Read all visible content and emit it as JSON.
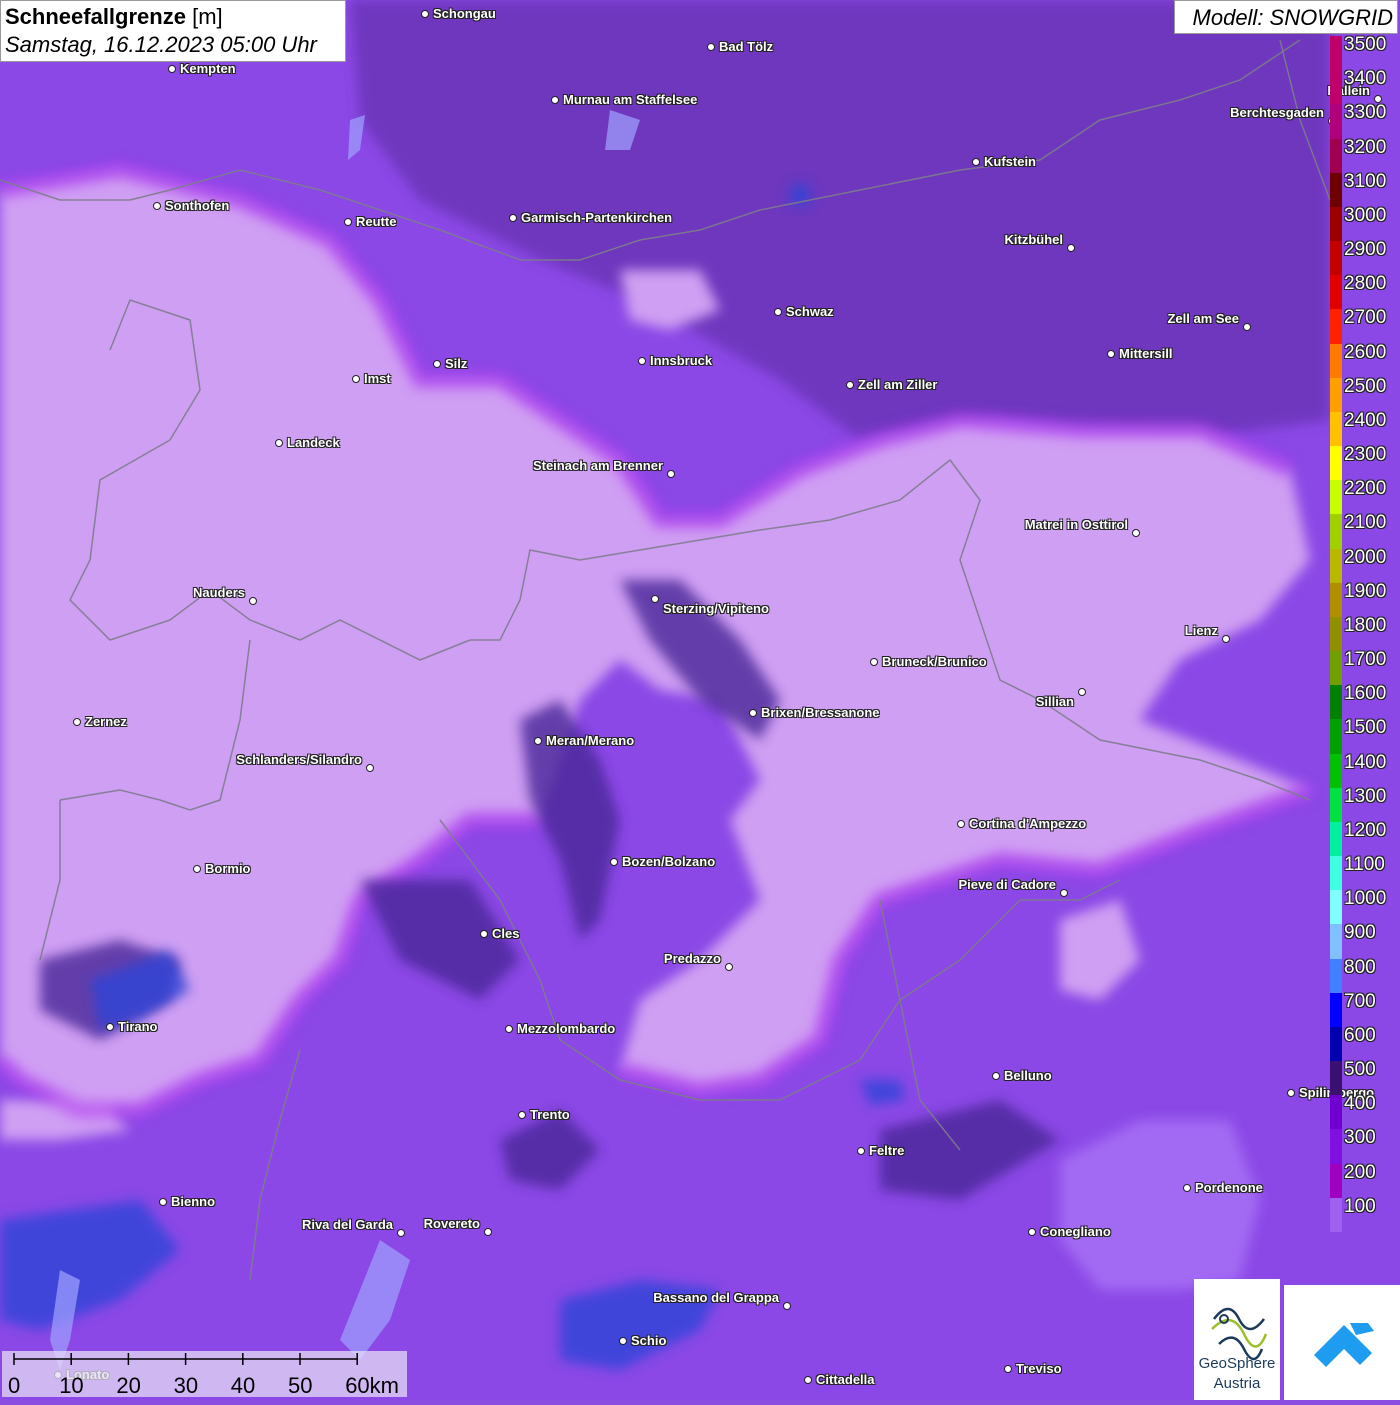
{
  "title": {
    "parameter": "Schneefallgrenze",
    "unit": "[m]",
    "datetime": "Samstag, 16.12.2023 05:00 Uhr"
  },
  "model": "Modell: SNOWGRID",
  "legend": {
    "labels": [
      "3500",
      "3400",
      "3300",
      "3200",
      "3100",
      "3000",
      "2900",
      "2800",
      "2700",
      "2600",
      "2500",
      "2400",
      "2300",
      "2200",
      "2100",
      "2000",
      "1900",
      "1800",
      "1700",
      "1600",
      "1500",
      "1400",
      "1300",
      "1200",
      "1100",
      "1000",
      "900",
      "800",
      "700",
      "600",
      "500",
      "400",
      "300",
      "200",
      "100"
    ],
    "colors": [
      "#c0006a",
      "#c0006a",
      "#b0007a",
      "#a00050",
      "#6e0000",
      "#9a0000",
      "#c20000",
      "#e00000",
      "#ff2000",
      "#ff7a00",
      "#ffa000",
      "#ffc000",
      "#ffff00",
      "#c8ff00",
      "#a0d000",
      "#b8b800",
      "#b09000",
      "#909000",
      "#70a000",
      "#008000",
      "#00a000",
      "#00c000",
      "#00e040",
      "#00f0a0",
      "#40ffe0",
      "#80ffff",
      "#80c0ff",
      "#4080ff",
      "#0000ff",
      "#0000b0",
      "#3a1070",
      "#7000d0",
      "#8010e0",
      "#a000c0",
      "#a060f0"
    ]
  },
  "cities": [
    {
      "name": "Schongau"
    },
    {
      "name": "Kempten"
    },
    {
      "name": "Bad Tölz"
    },
    {
      "name": "Murnau am Staffelsee"
    },
    {
      "name": "Hallein"
    },
    {
      "name": "Berchtesgaden"
    },
    {
      "name": "Kufstein"
    },
    {
      "name": "Sonthofen"
    },
    {
      "name": "Reutte"
    },
    {
      "name": "Garmisch-Partenkirchen"
    },
    {
      "name": "Kitzbühel"
    },
    {
      "name": "Schwaz"
    },
    {
      "name": "Zell am See"
    },
    {
      "name": "Mittersill"
    },
    {
      "name": "Innsbruck"
    },
    {
      "name": "Imst"
    },
    {
      "name": "Silz"
    },
    {
      "name": "Zell am Ziller"
    },
    {
      "name": "Landeck"
    },
    {
      "name": "Steinach am Brenner"
    },
    {
      "name": "Matrei in Osttirol"
    },
    {
      "name": "Nauders"
    },
    {
      "name": "Sterzing/Vipiteno"
    },
    {
      "name": "Lienz"
    },
    {
      "name": "Bruneck/Brunico"
    },
    {
      "name": "Sillian"
    },
    {
      "name": "Zernez"
    },
    {
      "name": "Brixen/Bressanone"
    },
    {
      "name": "Meran/Merano"
    },
    {
      "name": "Schlanders/Silandro"
    },
    {
      "name": "Cortina d'Ampezzo"
    },
    {
      "name": "Bozen/Bolzano"
    },
    {
      "name": "Bormio"
    },
    {
      "name": "Pieve di Cadore"
    },
    {
      "name": "Cles"
    },
    {
      "name": "Predazzo"
    },
    {
      "name": "Tirano"
    },
    {
      "name": "Mezzolombardo"
    },
    {
      "name": "Belluno"
    },
    {
      "name": "Spilimbergo"
    },
    {
      "name": "Trento"
    },
    {
      "name": "Feltre"
    },
    {
      "name": "Pordenone"
    },
    {
      "name": "Bienno"
    },
    {
      "name": "Riva del Garda"
    },
    {
      "name": "Rovereto"
    },
    {
      "name": "Conegliano"
    },
    {
      "name": "Bassano del Grappa"
    },
    {
      "name": "Schio"
    },
    {
      "name": "Treviso"
    },
    {
      "name": "Cittadella"
    },
    {
      "name": "Lonato"
    }
  ],
  "scalebar": {
    "labels": [
      "0",
      "10",
      "20",
      "30",
      "40",
      "50",
      "60km"
    ]
  },
  "logos": {
    "geosphere": [
      "GeoSphere",
      "Austria"
    ]
  }
}
